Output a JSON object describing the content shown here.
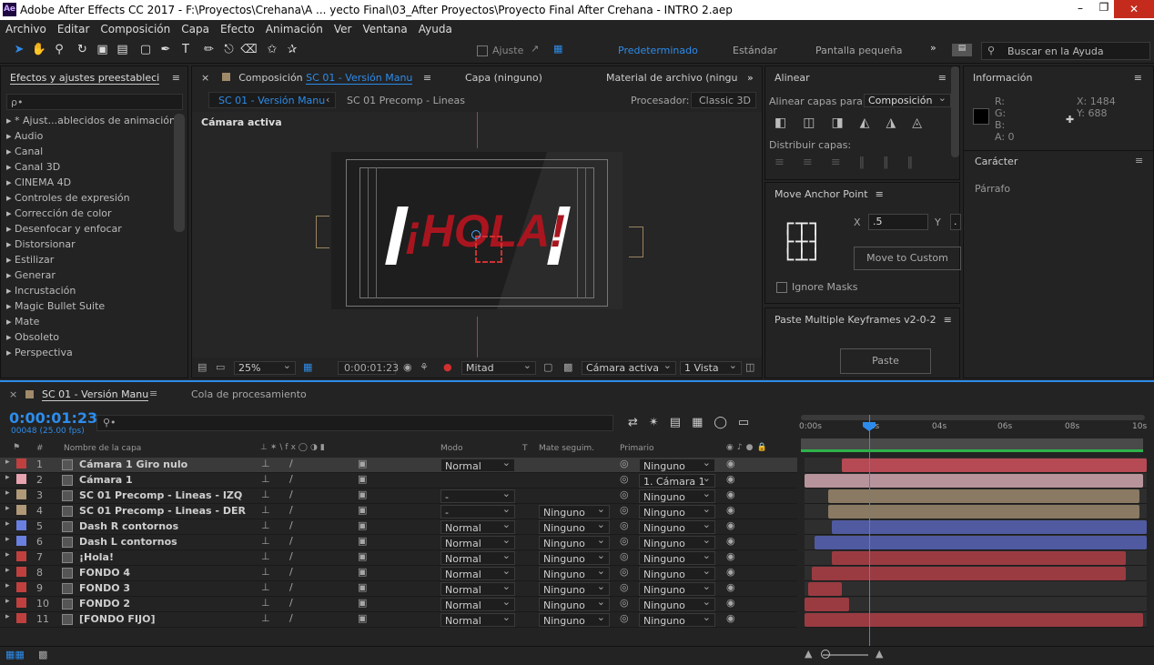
{
  "app": {
    "title": "Adobe After Effects CC 2017 - F:\\Proyectos\\Crehana\\A ... yecto Final\\03_After Proyectos\\Proyecto Final After Crehana - INTRO 2.aep",
    "icon": "Ae"
  },
  "menu": [
    "Archivo",
    "Editar",
    "Composición",
    "Capa",
    "Efecto",
    "Animación",
    "Ver",
    "Ventana",
    "Ayuda"
  ],
  "toolbar": {
    "ajuste": "Ajuste",
    "workspaces": [
      "Predeterminado",
      "Estándar",
      "Pantalla pequeña"
    ],
    "search_placeholder": "Buscar en la Ayuda"
  },
  "effects": {
    "title": "Efectos y ajustes preestableci",
    "search_placeholder": "ρ•",
    "items": [
      "* Ajust...ablecidos de animación",
      "Audio",
      "Canal",
      "Canal 3D",
      "CINEMA 4D",
      "Controles de expresión",
      "Corrección de color",
      "Desenfocar y enfocar",
      "Distorsionar",
      "Estilizar",
      "Generar",
      "Incrustación",
      "Magic Bullet Suite",
      "Mate",
      "Obsoleto",
      "Perspectiva"
    ]
  },
  "comp": {
    "tab_prefix": "Composición",
    "tab_name": "SC 01 - Versión Manu",
    "layer_tab": "Capa  (ninguno)",
    "material_tab": "Material de archivo  (ningu",
    "sub_tab1": "SC 01 - Versión Manu",
    "sub_tab2": "SC 01 Precomp - Lineas",
    "renderer_label": "Procesador:",
    "renderer": "Classic 3D",
    "camera_label": "Cámara activa",
    "hola": "¡HOLA!",
    "zoom": "25%",
    "timecode": "0:00:01:23",
    "resolution": "Mitad",
    "view": "Cámara activa",
    "views": "1 Vista"
  },
  "align": {
    "title": "Alinear",
    "align_to_label": "Alinear capas para:",
    "align_to": "Composición",
    "distribute": "Distribuir capas:"
  },
  "anchor": {
    "title": "Move Anchor Point",
    "x_label": "X",
    "x_value": ".5",
    "y_label": "Y",
    "y_value": ".",
    "button": "Move to Custom",
    "ignore_masks": "Ignore Masks"
  },
  "paste": {
    "title": "Paste Multiple Keyframes v2-0-2",
    "button": "Paste"
  },
  "info": {
    "title": "Información",
    "r": "R:",
    "g": "G:",
    "b": "B:",
    "a": "A:  0",
    "x": "X:  1484",
    "y": "Y:   688",
    "caracter": "Carácter",
    "parrafo": "Párrafo"
  },
  "timeline": {
    "tab": "SC 01 - Versión Manu",
    "render_tab": "Cola de procesamiento",
    "timecode": "0:00:01:23",
    "frames": "00048 (25.00 fps)",
    "col_name": "Nombre de la capa",
    "col_mode": "Modo",
    "col_t": "T",
    "col_track": "Mate seguim.",
    "col_parent": "Primario",
    "ruler": [
      "0:00s",
      "02s",
      "04s",
      "06s",
      "08s",
      "10s"
    ],
    "layers": [
      {
        "num": "1",
        "name": "Cámara 1 Giro nulo",
        "color": "#c04040",
        "mode": "Normal",
        "track": "",
        "parent": "Ninguno",
        "selected": true,
        "bar_start": 0.11,
        "bar_end": 1.0,
        "bar_color": "#b54a55"
      },
      {
        "num": "2",
        "name": "Cámara 1",
        "color": "#e8a3b0",
        "mode": "",
        "track": "",
        "parent": "1. Cámara 1 G",
        "selected": false,
        "bar_start": 0.0,
        "bar_end": 0.99,
        "bar_color": "#b7949c"
      },
      {
        "num": "3",
        "name": "SC 01 Precomp - Lineas - IZQ",
        "color": "#b09878",
        "mode": "-",
        "track": "",
        "parent": "Ninguno",
        "selected": false,
        "bar_start": 0.07,
        "bar_end": 0.98,
        "bar_color": "#8a7a63"
      },
      {
        "num": "4",
        "name": "SC 01 Precomp - Lineas - DER",
        "color": "#b09878",
        "mode": "-",
        "track": "Ninguno",
        "parent": "Ninguno",
        "selected": false,
        "bar_start": 0.07,
        "bar_end": 0.98,
        "bar_color": "#8a7a63"
      },
      {
        "num": "5",
        "name": "Dash R contornos",
        "color": "#6a80e0",
        "mode": "Normal",
        "track": "Ninguno",
        "parent": "Ninguno",
        "selected": false,
        "bar_start": 0.08,
        "bar_end": 1.0,
        "bar_color": "#505aa0"
      },
      {
        "num": "6",
        "name": "Dash L contornos",
        "color": "#6a80e0",
        "mode": "Normal",
        "track": "Ninguno",
        "parent": "Ninguno",
        "selected": false,
        "bar_start": 0.03,
        "bar_end": 1.0,
        "bar_color": "#505aa0"
      },
      {
        "num": "7",
        "name": "¡Hola!",
        "color": "#c04040",
        "mode": "Normal",
        "track": "Ninguno",
        "parent": "Ninguno",
        "selected": false,
        "bar_start": 0.08,
        "bar_end": 0.94,
        "bar_color": "#9a3b42"
      },
      {
        "num": "8",
        "name": "FONDO 4",
        "color": "#c04040",
        "mode": "Normal",
        "track": "Ninguno",
        "parent": "Ninguno",
        "selected": false,
        "bar_start": 0.02,
        "bar_end": 0.94,
        "bar_color": "#9a3b42"
      },
      {
        "num": "9",
        "name": "FONDO 3",
        "color": "#c04040",
        "mode": "Normal",
        "track": "Ninguno",
        "parent": "Ninguno",
        "selected": false,
        "bar_start": 0.01,
        "bar_end": 0.11,
        "bar_color": "#9a3b42"
      },
      {
        "num": "10",
        "name": "FONDO 2",
        "color": "#c04040",
        "mode": "Normal",
        "track": "Ninguno",
        "parent": "Ninguno",
        "selected": false,
        "bar_start": 0.0,
        "bar_end": 0.13,
        "bar_color": "#9a3b42"
      },
      {
        "num": "11",
        "name": "[FONDO FIJO]",
        "color": "#c04040",
        "mode": "Normal",
        "track": "Ninguno",
        "parent": "Ninguno",
        "selected": false,
        "bar_start": 0.0,
        "bar_end": 0.99,
        "bar_color": "#9a3b42"
      }
    ]
  }
}
